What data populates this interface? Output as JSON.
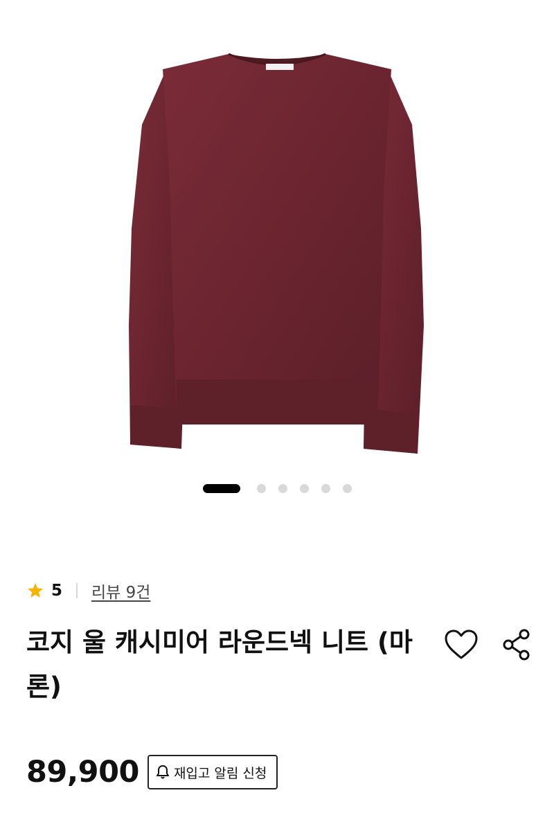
{
  "product": {
    "image_icon": "maroon-round-neck-sweater-image",
    "image_count": 6,
    "active_image": 0,
    "sweater_color": "#6b2530",
    "rating": "5",
    "review_link": "리뷰 9건",
    "title": "코지 울 캐시미어 라운드넥 니트 (마론)",
    "price": "89,900",
    "restock_button": "재입고 알림 신청"
  },
  "icons": {
    "star": "star-icon",
    "wishlist": "heart-icon",
    "share": "share-icon",
    "bell": "bell-icon"
  },
  "colors": {
    "star": "#f4b400",
    "pager_active": "#000000",
    "pager_inactive": "#d9d9d9"
  }
}
